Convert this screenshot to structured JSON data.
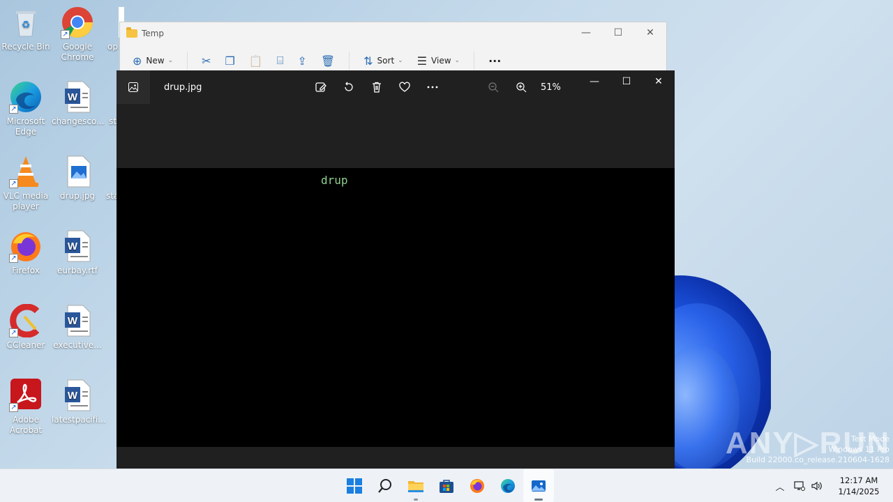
{
  "desktop": {
    "icons": [
      {
        "label": "Recycle Bin"
      },
      {
        "label": "Google Chrome"
      },
      {
        "label": "op"
      },
      {
        "label": "Microsoft Edge"
      },
      {
        "label": "changesco..."
      },
      {
        "label": "st"
      },
      {
        "label": "VLC media player"
      },
      {
        "label": "drup.jpg"
      },
      {
        "label": "sta"
      },
      {
        "label": "Firefox"
      },
      {
        "label": "eurbay.rtf"
      },
      {
        "label": "CCleaner"
      },
      {
        "label": "executive..."
      },
      {
        "label": "Adobe Acrobat"
      },
      {
        "label": "latestpacifi..."
      }
    ]
  },
  "explorer": {
    "title": "Temp",
    "commands": {
      "new_label": "New",
      "sort_label": "Sort",
      "view_label": "View",
      "more": "···"
    }
  },
  "photos": {
    "filename": "drup.jpg",
    "zoom": "51%",
    "image_text": "drup"
  },
  "watermark": {
    "brand": "ANY▷RUN",
    "line1": "Test Mode",
    "line2": "Windows 11 Pro",
    "line3": "Build 22000.co_release.210604-1628"
  },
  "taskbar": {
    "time": "12:17 AM",
    "date": "1/14/2025"
  },
  "colors": {
    "photos_bg": "#202020",
    "image_text": "#8fd08f",
    "accent": "#2b6cb3"
  }
}
